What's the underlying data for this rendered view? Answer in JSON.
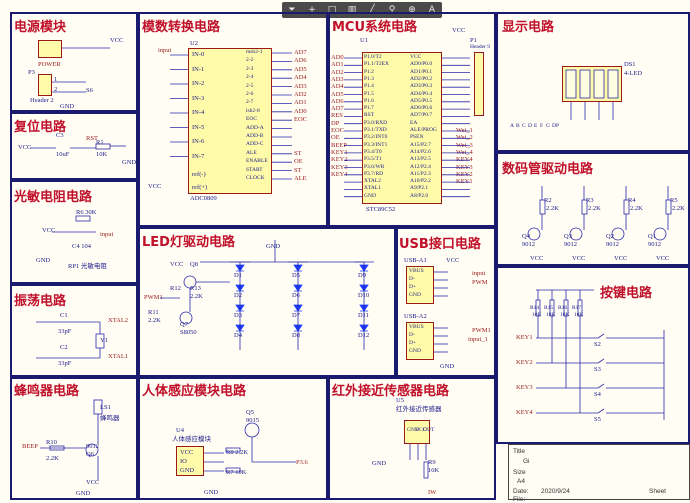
{
  "sections": {
    "power": "电源模块",
    "adc": "模数转换电路",
    "mcu": "MCU系统电路",
    "display": "显示电路",
    "reset": "复位电路",
    "digit_driver": "数码管驱动电路",
    "photoresistor": "光敏电阻电路",
    "led_driver": "LED灯驱动电路",
    "usb": "USB接口电路",
    "oscillator": "振荡电路",
    "keys": "按键电路",
    "buzzer": "蜂鸣器电路",
    "pir": "人体感应模块电路",
    "ir": "红外接近传感器电路"
  },
  "toolbar": {
    "filter_icon": "⏷",
    "add_icon": "+",
    "rect_icon": "□",
    "bars_icon": "▥",
    "line_icon": "╱",
    "pin_icon": "⚲",
    "target_icon": "⊕",
    "text_icon": "A"
  },
  "power": {
    "vcc": "VCC",
    "gnd": "GND",
    "power_label": "POWER",
    "p3": "P3",
    "header2": "Header 2",
    "s6": "S6",
    "j1": "1",
    "j2": "2"
  },
  "adc": {
    "u2": "U2",
    "chip": "ADC0809",
    "input": "input",
    "in_pins": [
      "IN-0",
      "IN-1",
      "IN-2",
      "IN-3",
      "IN-4",
      "IN-5",
      "IN-6",
      "IN-7"
    ],
    "right_pins": [
      "msb2-1",
      "2-2",
      "2-3",
      "2-4",
      "2-5",
      "2-6",
      "2-7",
      "lsb2-8",
      "EOC",
      "ADD-A",
      "ADD-B",
      "ADD-C",
      "ALE",
      "ENABLE",
      "START",
      "CLOCK"
    ],
    "right_nets": [
      "AD7",
      "AD6",
      "AD5",
      "AD4",
      "AD3",
      "AD2",
      "AD1",
      "AD0",
      "EOC",
      "",
      "",
      "",
      "ST",
      "OE",
      "ST",
      "ALE"
    ],
    "ref_plus": "ref(+)",
    "ref_minus": "ref(-)",
    "vcc": "VCC",
    "gnd": "GND"
  },
  "mcu": {
    "u1": "U1",
    "chip": "STC89C52",
    "vcc": "VCC",
    "p1": "P1",
    "header9": "Header 9",
    "left_nets": [
      "AD0",
      "AD1",
      "AD2",
      "AD3",
      "AD4",
      "AD5",
      "AD6",
      "AD7",
      "RES",
      "DP",
      "EOC",
      "OE",
      "BEEP",
      "KEY1",
      "KEY2",
      "KEY3",
      "KEY4"
    ],
    "left_pins": [
      "P1.0/T2",
      "P1.1/T2EX",
      "P1.2",
      "P1.3",
      "P1.4",
      "P1.5",
      "P1.6",
      "P1.7",
      "RST",
      "P3.0/RXD",
      "P3.1/TXD",
      "P3.2/INT0",
      "P3.3/INT1",
      "P3.4/T0",
      "P3.5/T1",
      "P3.6/WR",
      "P3.7/RD",
      "XTAL2",
      "XTAL1",
      "GND"
    ],
    "right_pins": [
      "VCC",
      "AD0/P0.0",
      "AD1/P0.1",
      "AD2/P0.2",
      "AD3/P0.3",
      "AD4/P0.4",
      "AD5/P0.5",
      "AD6/P0.6",
      "AD7/P0.7",
      "EA",
      "ALE/PROG",
      "PSEN",
      "A15/P2.7",
      "A14/P2.6",
      "A13/P2.5",
      "A12/P2.4",
      "A11/P2.3",
      "A10/P2.2",
      "A9/P2.1",
      "A8/P2.0"
    ],
    "right_nets": [
      "",
      "",
      "",
      "",
      "",
      "",
      "",
      "",
      "",
      "",
      "Wei_1",
      "Wei_2",
      "Wei_3",
      "Wei_4",
      "KEY4",
      "KEY3",
      "KEY2",
      "KEY1",
      "",
      ""
    ],
    "xtal": [
      "XTAL2",
      "XTAL1"
    ]
  },
  "display": {
    "ds": "DS1",
    "led": "4-LED",
    "ann": [
      "A",
      "B",
      "C",
      "D",
      "E",
      "F",
      "G",
      "DP"
    ]
  },
  "reset": {
    "vcc": "VCC",
    "c3": "C3",
    "c3v": "10uF",
    "r1": "R1",
    "r1v": "10K",
    "rst": "RST",
    "gnd": "GND"
  },
  "photo": {
    "vcc": "VCC",
    "r6": "R6 30K",
    "c4": "C4 104",
    "rp1": "RP1 光敏电阻",
    "gnd": "GND",
    "net": "input"
  },
  "osc": {
    "c1": "C1",
    "c1v": "33pF",
    "c2": "C2",
    "c2v": "33pF",
    "y1": "Y1",
    "x2": "XTAL2",
    "x1": "XTAL1"
  },
  "buzzer": {
    "ls1": "LS1",
    "name": "蜂鸣器",
    "beep": "BEEP",
    "r10": "R10",
    "r10v": "2.2K",
    "q6": "9012",
    "q": "Q6",
    "vcc": "VCC",
    "gnd": "GND"
  },
  "pir": {
    "u4": "U4",
    "name": "人体感应模块",
    "pins": [
      "VCC",
      "IO",
      "GND"
    ],
    "q5": "Q5",
    "q5v": "9015",
    "r8": "R8 2.2K",
    "r7": "R7 10K",
    "net": "P3.6",
    "gnd": "GND"
  },
  "led": {
    "gnd": "GND",
    "vcc": "VCC",
    "pwm": "PWM1",
    "q8": "Q8",
    "r10": "R11",
    "r11v": "2.2K",
    "q7": "Q7",
    "q7v": "S8050",
    "r_a": "R12",
    "r_b": "R13",
    "rv": "2.2K",
    "diodes": [
      "D1",
      "D2",
      "D3",
      "D4",
      "D5",
      "D6",
      "D7",
      "D8",
      "D9",
      "D10",
      "D11",
      "D12"
    ]
  },
  "usb": {
    "a1": "USB-A1",
    "a2": "USB-A2",
    "pins": [
      "VBUS",
      "D-",
      "D+",
      "GND"
    ],
    "vcc": "VCC",
    "pwm": "PWM",
    "input": "input",
    "pwm1": "PWM1",
    "input1": "input_1",
    "gnd": "GND"
  },
  "digit": {
    "r": [
      "R2",
      "R3",
      "R4",
      "R5"
    ],
    "rv": "2.2K",
    "q": [
      "Q4",
      "Q3",
      "Q2",
      "Q1"
    ],
    "qv": "9012",
    "vcc": "VCC",
    "wei": [
      "Wei_1",
      "Wei_2",
      "Wei_3",
      "Wei_4"
    ]
  },
  "keys": {
    "r": [
      "R14",
      "R15",
      "R16",
      "R17"
    ],
    "rv": "10K",
    "keys": [
      "KEY1",
      "KEY2",
      "KEY3",
      "KEY4"
    ],
    "s": [
      "S2",
      "S3",
      "S4",
      "S5"
    ],
    "vcc": "VCC",
    "gnd": "GND"
  },
  "ir": {
    "u5": "U5",
    "name": "红外接近传感器",
    "pins": [
      "GND",
      "VCC",
      "OUT"
    ],
    "r9": "R9",
    "r9v": "10K",
    "gnd": "GND",
    "net": "IW"
  },
  "titleblock": {
    "title": "Title",
    "gi": "Gi",
    "size": "Size",
    "a4": "A4",
    "date_label": "Date:",
    "date": "2020/9/24",
    "file_label": "File:",
    "sheet": "Sheet"
  }
}
